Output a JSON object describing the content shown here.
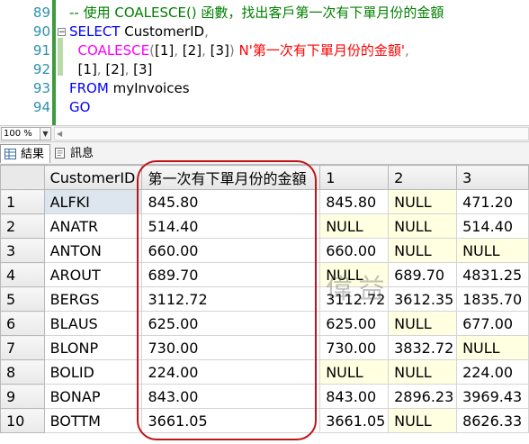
{
  "editor": {
    "lines": [
      {
        "num": "89",
        "segments": [
          {
            "text": "-- 使用 COALESCE() 函數，找出客戶第一次有下單月份的金額",
            "cls": "c-comment"
          }
        ]
      },
      {
        "num": "90",
        "fold": "−",
        "segments": [
          {
            "text": "SELECT ",
            "cls": "c-kw"
          },
          {
            "text": "CustomerID",
            "cls": "c-id"
          },
          {
            "text": ",",
            "cls": "c-gray"
          }
        ]
      },
      {
        "num": "91",
        "segments": [
          {
            "text": "  ",
            "cls": "c-id"
          },
          {
            "text": "COALESCE",
            "cls": "c-fn"
          },
          {
            "text": "(",
            "cls": "c-gray"
          },
          {
            "text": "[1]",
            "cls": "c-id"
          },
          {
            "text": ", ",
            "cls": "c-gray"
          },
          {
            "text": "[2]",
            "cls": "c-id"
          },
          {
            "text": ", ",
            "cls": "c-gray"
          },
          {
            "text": "[3]",
            "cls": "c-id"
          },
          {
            "text": ") ",
            "cls": "c-gray"
          },
          {
            "text": "N'第一次有下單月份的金額'",
            "cls": "c-str"
          },
          {
            "text": ",",
            "cls": "c-gray"
          }
        ]
      },
      {
        "num": "92",
        "segments": [
          {
            "text": "  ",
            "cls": "c-id"
          },
          {
            "text": "[1]",
            "cls": "c-id"
          },
          {
            "text": ", ",
            "cls": "c-gray"
          },
          {
            "text": "[2]",
            "cls": "c-id"
          },
          {
            "text": ", ",
            "cls": "c-gray"
          },
          {
            "text": "[3]",
            "cls": "c-id"
          }
        ]
      },
      {
        "num": "93",
        "segments": [
          {
            "text": "FROM ",
            "cls": "c-kw"
          },
          {
            "text": "myInvoices",
            "cls": "c-id"
          }
        ]
      },
      {
        "num": "94",
        "segments": [
          {
            "text": "GO",
            "cls": "c-kw"
          }
        ]
      }
    ]
  },
  "zoom": {
    "value": "100 %"
  },
  "tabs": [
    {
      "label": "結果",
      "icon": "grid-results-icon",
      "active": true
    },
    {
      "label": "訊息",
      "icon": "messages-icon",
      "active": false
    }
  ],
  "grid": {
    "columns": [
      "CustomerID",
      "第一次有下單月份的金額",
      "1",
      "2",
      "3"
    ],
    "rows": [
      [
        "1",
        "ALFKI",
        "845.80",
        "845.80",
        "NULL",
        "471.20"
      ],
      [
        "2",
        "ANATR",
        "514.40",
        "NULL",
        "NULL",
        "514.40"
      ],
      [
        "3",
        "ANTON",
        "660.00",
        "660.00",
        "NULL",
        "NULL"
      ],
      [
        "4",
        "AROUT",
        "689.70",
        "NULL",
        "689.70",
        "4831.25"
      ],
      [
        "5",
        "BERGS",
        "3112.72",
        "3112.72",
        "3612.35",
        "1835.70"
      ],
      [
        "6",
        "BLAUS",
        "625.00",
        "625.00",
        "NULL",
        "677.00"
      ],
      [
        "7",
        "BLONP",
        "730.00",
        "730.00",
        "3832.72",
        "NULL"
      ],
      [
        "8",
        "BOLID",
        "224.00",
        "NULL",
        "NULL",
        "224.00"
      ],
      [
        "9",
        "BONAP",
        "843.00",
        "843.00",
        "2896.23",
        "3969.43"
      ],
      [
        "10",
        "BOTTM",
        "3661.05",
        "3661.05",
        "NULL",
        "8626.33"
      ]
    ]
  },
  "highlight_color": "#c0141a",
  "null_cell_color": "#ffffe1",
  "watermark": "偉益"
}
